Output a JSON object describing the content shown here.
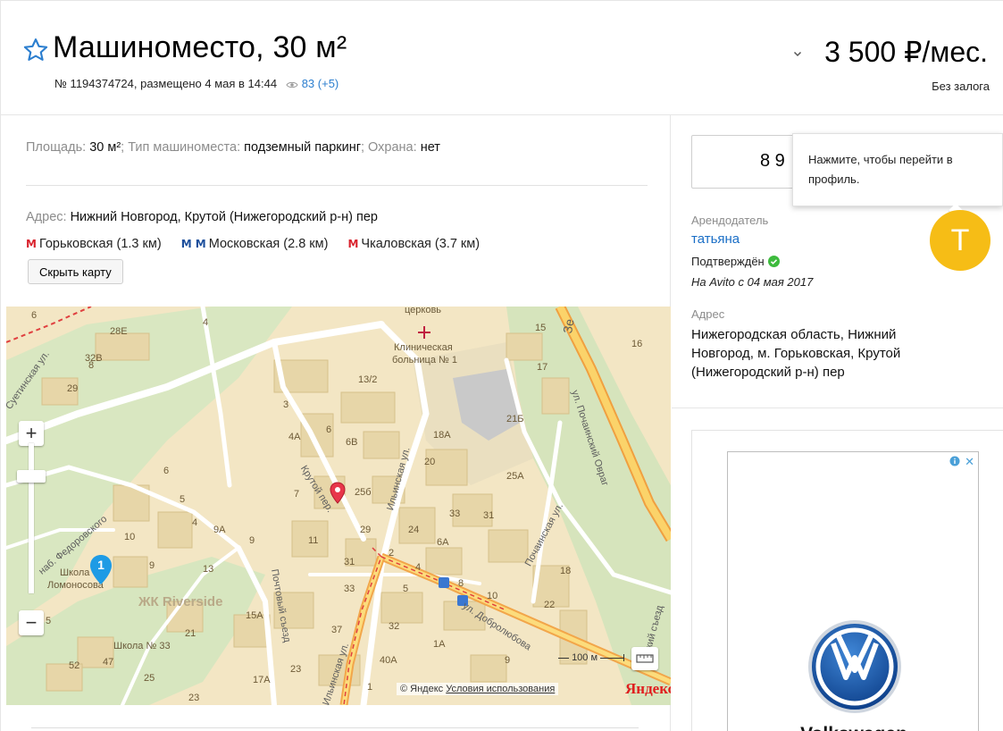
{
  "listing": {
    "title": "Машиноместо, 30 м²",
    "meta_text": "№ 1194374724, размещено 4 мая в 14:44",
    "views": "83 (+5)",
    "price": "3 500 ₽/мес.",
    "deposit": "Без залога"
  },
  "params": {
    "area_label": "Площадь:",
    "area_value": "30 м²",
    "type_label": "; Тип машиноместа:",
    "type_value": "подземный паркинг",
    "security_label": "; Охрана:",
    "security_value": "нет"
  },
  "address": {
    "label": "Адрес:",
    "value": "Нижний Новгород, Крутой (Нижегородский р-н) пер",
    "metro": [
      {
        "icon": "М",
        "name": "Горьковская (1.3 км)"
      },
      {
        "icon": "М М",
        "name": "Московская (2.8 км)"
      },
      {
        "icon": "М",
        "name": "Чкаловская (3.7 км)"
      }
    ],
    "hide_map_label": "Скрыть карту"
  },
  "map": {
    "labels": {
      "church": "церковь",
      "hospital_1": "Клиническая",
      "hospital_2": "больница № 1",
      "school_lom_1": "Школа",
      "school_lom_2": "Ломоносова",
      "riverside": "ЖК Riverside",
      "school33": "Школа № 33",
      "pin_blue_num": "1"
    },
    "streets": {
      "suetinsky": "Суетинская ул.",
      "fedorovsky": "наб. Федоровского",
      "krutoy": "Крутой пер.",
      "ilinskaya": "Ильинская ул.",
      "pochtovy": "Почтовый съезд",
      "pochainskaya": "Почаинская ул.",
      "pochainsky_ovrag": "ул. Почаинский Овраг",
      "dobrolyubova": "ул. Добролюбова",
      "ilinskaya2": "Ильинская ул.",
      "sjezd": "ский съезд",
      "ze": "Зе"
    },
    "houses": [
      "6",
      "28Е",
      "4",
      "32В",
      "29",
      "15",
      "16",
      "17",
      "13/2",
      "3",
      "4А",
      "6",
      "6В",
      "18А",
      "21Б",
      "20",
      "25А",
      "7",
      "25б",
      "33",
      "31",
      "29",
      "24",
      "6А",
      "6",
      "5",
      "4",
      "9А",
      "9",
      "10",
      "11",
      "31",
      "2",
      "4",
      "18",
      "13",
      "9",
      "33",
      "5",
      "8",
      "10",
      "22",
      "15А",
      "37",
      "32",
      "1А",
      "21",
      "47",
      "52",
      "25",
      "23",
      "17А",
      "40А",
      "9",
      "1",
      "5",
      "23",
      "8"
    ],
    "scale": "100 м",
    "copyright": "© Яндекс",
    "terms": "Условия использования",
    "yandex_logo": "Яндекс"
  },
  "seller": {
    "phone": "8 9",
    "tooltip": "Нажмите, чтобы перейти в профиль.",
    "caption": "Арендодатель",
    "name": "татьяна",
    "verified": "Подтверждён",
    "on_since": "На Avito с 04 мая 2017",
    "avatar_letter": "T",
    "address_caption": "Адрес",
    "address_full": "Нижегородская область, Нижний Новгород, м. Горьковская, Крутой (Нижегородский р-н) пер"
  },
  "ad": {
    "brand": "Volkswagen",
    "close": "✕"
  },
  "colors": {
    "link": "#1a6ec6",
    "metro_red": "#d9232e",
    "metro_blue": "#1d4f9c",
    "avatar": "#f6bd16",
    "verified": "#3dbb3d"
  }
}
